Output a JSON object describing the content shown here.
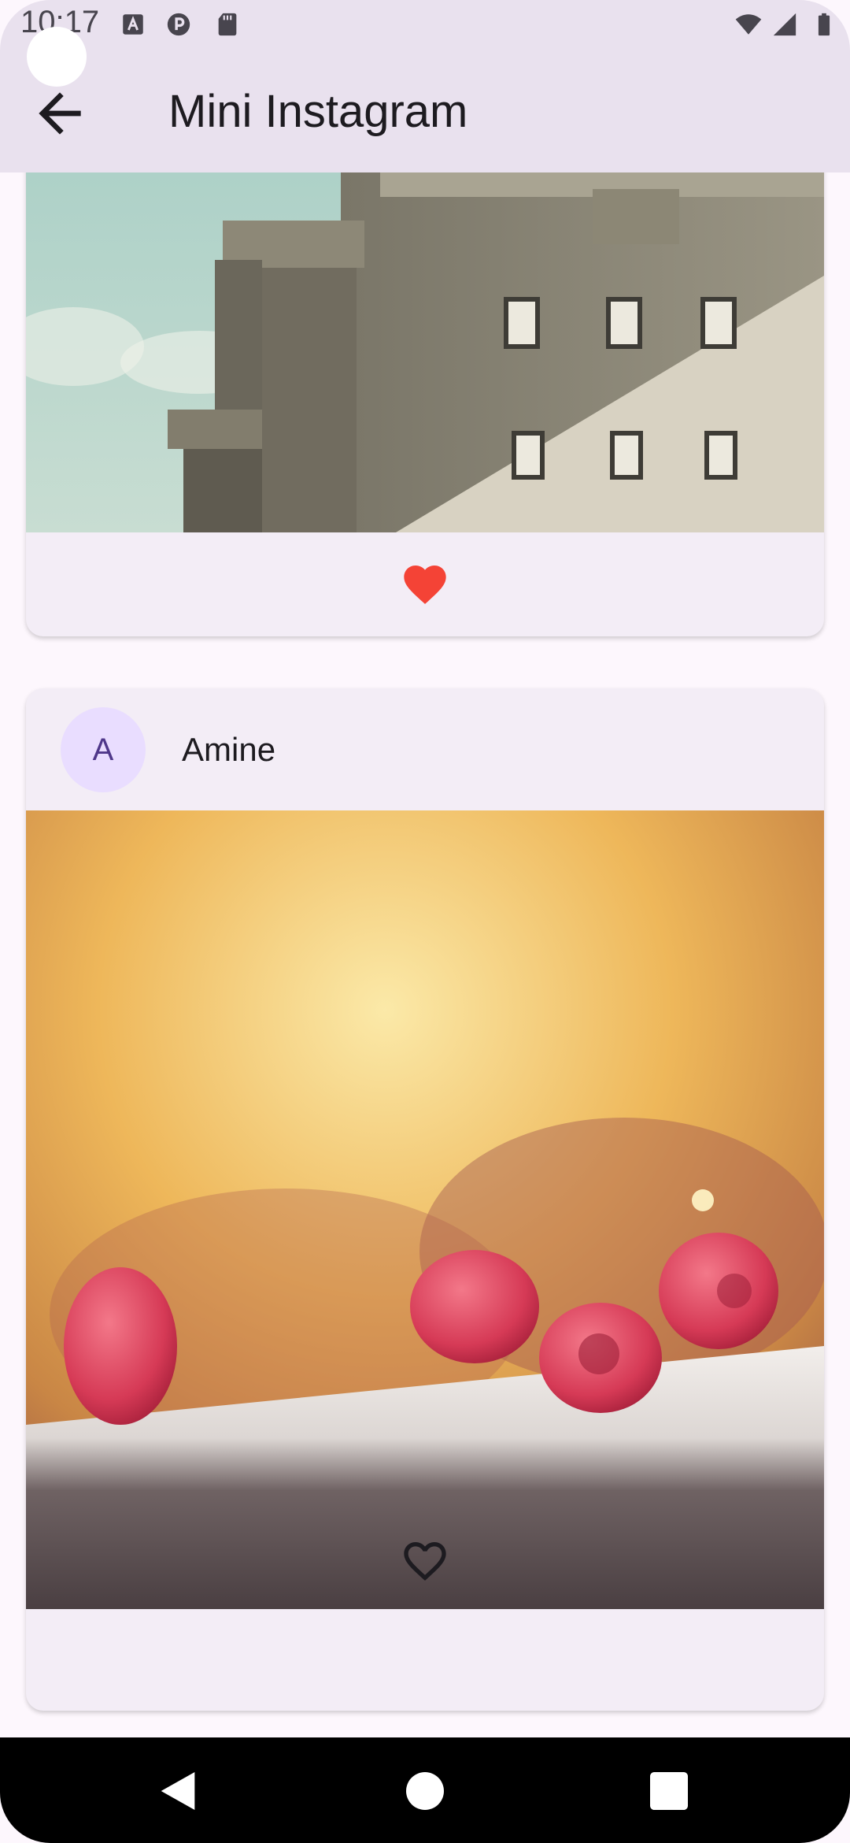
{
  "status_bar": {
    "time": "10:17",
    "left_icons": [
      "keyboard-a-icon",
      "p-badge-icon",
      "sd-card-icon"
    ],
    "right_icons": [
      "wifi-icon",
      "cell-signal-icon",
      "battery-icon"
    ]
  },
  "app_bar": {
    "title": "Mini Instagram",
    "back_icon": "arrow-back-icon"
  },
  "feed": {
    "posts": [
      {
        "photo": "concrete-building-photo",
        "liked": true,
        "like_icon": "heart-filled-icon",
        "like_color": "#f44336"
      },
      {
        "avatar_initial": "A",
        "username": "Amine",
        "photo": "raspberries-photo",
        "liked": false,
        "like_icon": "heart-outline-icon"
      }
    ]
  },
  "nav_bar": {
    "buttons": [
      "back-triangle-icon",
      "home-circle-icon",
      "recents-square-icon"
    ]
  },
  "colors": {
    "app_bar_bg": "#e9e1ee",
    "page_bg": "#fdf7fd",
    "card_bg": "#f3edf6",
    "avatar_bg": "#e9ddff",
    "avatar_fg": "#4f378a"
  }
}
